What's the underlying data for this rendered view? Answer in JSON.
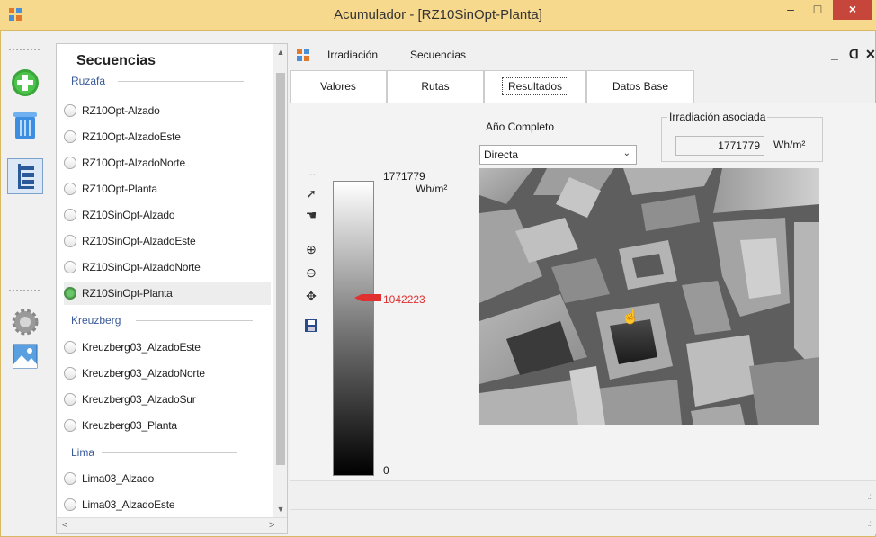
{
  "window": {
    "title": "Acumulador - [RZ10SinOpt-Planta]",
    "minimize": "–",
    "maximize": "□",
    "close": "×"
  },
  "toolbar": {
    "icons": [
      "add-icon",
      "trash-icon",
      "tree-icon",
      "settings-icon",
      "image-icon"
    ]
  },
  "sequences": {
    "title": "Secuencias",
    "groups": [
      {
        "name": "Ruzafa",
        "items": [
          "RZ10Opt-Alzado",
          "RZ10Opt-AlzadoEste",
          "RZ10Opt-AlzadoNorte",
          "RZ10Opt-Planta",
          "RZ10SinOpt-Alzado",
          "RZ10SinOpt-AlzadoEste",
          "RZ10SinOpt-AlzadoNorte",
          "RZ10SinOpt-Planta"
        ]
      },
      {
        "name": "Kreuzberg",
        "items": [
          "Kreuzberg03_AlzadoEste",
          "Kreuzberg03_AlzadoNorte",
          "Kreuzberg03_AlzadoSur",
          "Kreuzberg03_Planta"
        ]
      },
      {
        "name": "Lima",
        "items": [
          "Lima03_Alzado",
          "Lima03_AlzadoEste"
        ]
      }
    ],
    "selected": "RZ10SinOpt-Planta"
  },
  "menu": {
    "items": [
      "Irradiación",
      "Secuencias"
    ],
    "minimize": "_",
    "restore": "ᗡ",
    "close": "✕"
  },
  "tabs": [
    "Valores",
    "Rutas",
    "Resultados",
    "Datos Base"
  ],
  "active_tab": "Resultados",
  "results": {
    "period_label": "Año Completo",
    "type_select": "Directa",
    "assoc_legend": "Irradiación asociada",
    "assoc_value": "1771779",
    "assoc_unit": "Wh/m²",
    "legend_max": "1771779",
    "legend_unit": "Wh/m²",
    "legend_mark": "1042223",
    "legend_min": "0"
  },
  "colors": {
    "titlebar": "#f6d98c",
    "close": "#c7463c",
    "marker": "#e03030",
    "group": "#3a5a9a"
  }
}
